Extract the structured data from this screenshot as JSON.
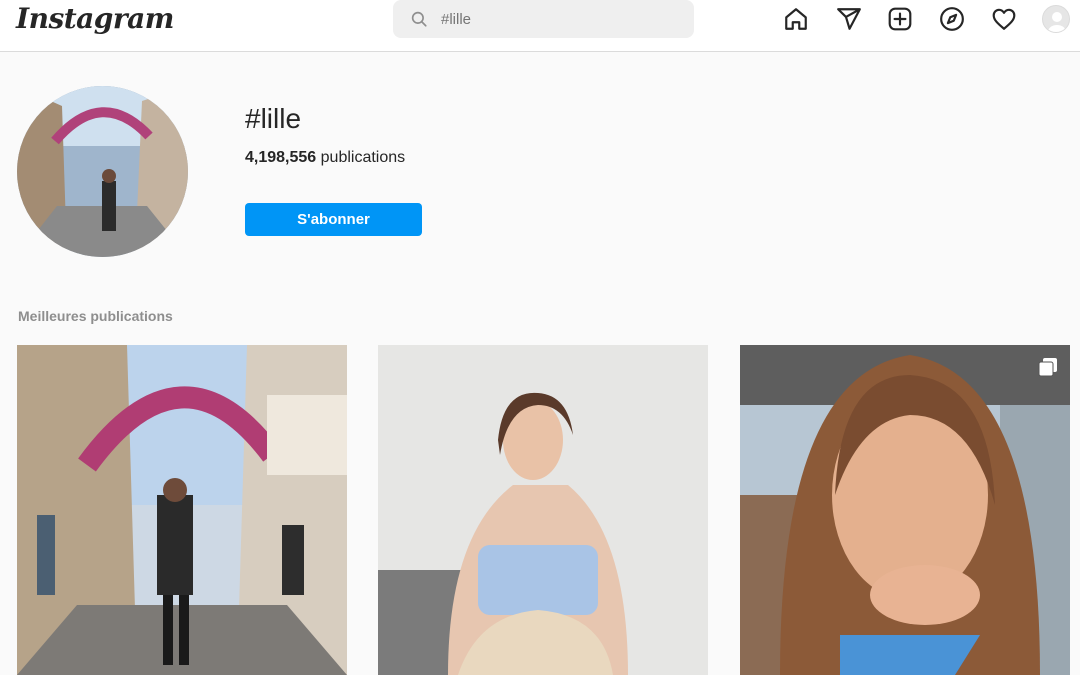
{
  "app": {
    "logo_text": "Instagram"
  },
  "search": {
    "placeholder": "#lille",
    "value": ""
  },
  "nav": {
    "icons": [
      "home-icon",
      "direct-icon",
      "new-post-icon",
      "explore-icon",
      "activity-icon",
      "profile-avatar"
    ]
  },
  "hashtag": {
    "title": "#lille",
    "count": "4,198,556",
    "count_label": "publications",
    "follow_label": "S'abonner"
  },
  "section": {
    "top_posts_label": "Meilleures publications"
  },
  "colors": {
    "accent": "#0095f6",
    "border": "#dbdbdb",
    "background": "#fafafa"
  }
}
